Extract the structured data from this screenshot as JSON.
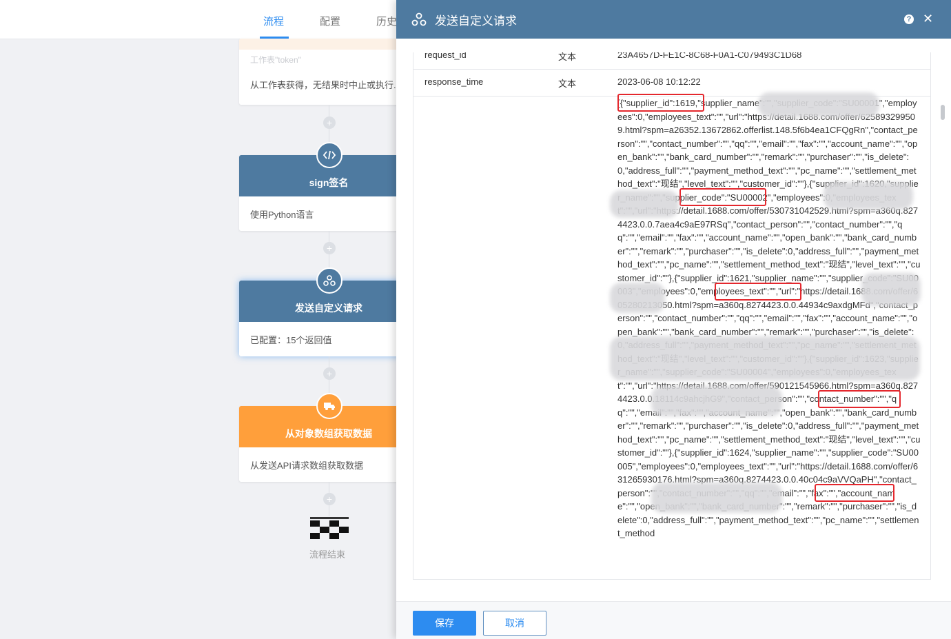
{
  "tabs": [
    {
      "label": "流程"
    },
    {
      "label": "配置"
    },
    {
      "label": "历史"
    }
  ],
  "flow": {
    "top_node_hint": "工作表\"token\"",
    "top_node_desc": "从工作表获得，无结果时中止或执行...",
    "node_sign_title": "sign签名",
    "node_sign_desc": "使用Python语言",
    "node_webhook_title": "发送自定义请求",
    "node_webhook_desc": "已配置：15个返回值",
    "node_array_title": "从对象数组获取数据",
    "node_array_desc": "从发送API请求数组获取数据",
    "end_label": "流程结束"
  },
  "drawer": {
    "title": "发送自定义请求",
    "help_icon": "?",
    "close_icon": "✕",
    "rows": [
      {
        "name": "request_id",
        "type": "文本",
        "value": "23A4657D-FE1C-8C68-F0A1-C079493C1D68"
      },
      {
        "name": "response_time",
        "type": "文本",
        "value": "2023-06-08 10:12:22"
      }
    ],
    "json_text": "[{\"supplier_id\":1619,\"supplier_name\":\"\",\"supplier_code\":\"SU00001\",\"employees\":0,\"employees_text\":\"\",\"url\":\"https://detail.1688.com/offer/625893299509.html?spm=a26352.13672862.offerlist.148.5f6b4ea1CFQgRn\",\"contact_person\":\"\",\"contact_number\":\"\",\"qq\":\"\",\"email\":\"\",\"fax\":\"\",\"account_name\":\"\",\"open_bank\":\"\",\"bank_card_number\":\"\",\"remark\":\"\",\"purchaser\":\"\",\"is_delete\":0,\"address_full\":\"\",\"payment_method_text\":\"\",\"pc_name\":\"\",\"settlement_method_text\":\"现结\",\"level_text\":\"\",\"customer_id\":\"\"},{\"supplier_id\":1620,\"supplier_name\":\"\",\"supplier_code\":\"SU00002\",\"employees\":0,\"employees_text\":\"\",\"url\":\"https://detail.1688.com/offer/530731042529.html?spm=a360q.8274423.0.0.7aea4c9aE97RSq\",\"contact_person\":\"\",\"contact_number\":\"\",\"qq\":\"\",\"email\":\"\",\"fax\":\"\",\"account_name\":\"\",\"open_bank\":\"\",\"bank_card_number\":\"\",\"remark\":\"\",\"purchaser\":\"\",\"is_delete\":0,\"address_full\":\"\",\"payment_method_text\":\"\",\"pc_name\":\"\",\"settlement_method_text\":\"现结\",\"level_text\":\"\",\"customer_id\":\"\"},{\"supplier_id\":1621,\"supplier_name\":\"\",\"supplier_code\":\"SU00003\",\"employees\":0,\"employees_text\":\"\",\"url\":\"https://detail.1688.com/offer/605280213050.html?spm=a360q.8274423.0.0.44934c9axdgMFd\",\"contact_person\":\"\",\"contact_number\":\"\",\"qq\":\"\",\"email\":\"\",\"fax\":\"\",\"account_name\":\"\",\"open_bank\":\"\",\"bank_card_number\":\"\",\"remark\":\"\",\"purchaser\":\"\",\"is_delete\":0,\"address_full\":\"\",\"payment_method_text\":\"\",\"pc_name\":\"\",\"settlement_method_text\":\"现结\",\"level_text\":\"\",\"customer_id\":\"\"},{\"supplier_id\":1623,\"supplier_name\":\"\",\"supplier_code\":\"SU00004\",\"employees\":0,\"employees_text\":\"\",\"url\":\"https://detail.1688.com/offer/590121545966.html?spm=a360q.8274423.0.0.18114c9ahcjhG9\",\"contact_person\":\"\",\"contact_number\":\"\",\"qq\":\"\",\"email\":\"\",\"fax\":\"\",\"account_name\":\"\",\"open_bank\":\"\",\"bank_card_number\":\"\",\"remark\":\"\",\"purchaser\":\"\",\"is_delete\":0,\"address_full\":\"\",\"payment_method_text\":\"\",\"pc_name\":\"\",\"settlement_method_text\":\"现结\",\"level_text\":\"\",\"customer_id\":\"\"},{\"supplier_id\":1624,\"supplier_name\":\"\",\"supplier_code\":\"SU00005\",\"employees\":0,\"employees_text\":\"\",\"url\":\"https://detail.1688.com/offer/631265930176.html?spm=a360q.8274423.0.0.40c04c9aVVQaPH\",\"contact_person\":\"\",\"contact_number\":\"\",\"qq\":\"\",\"email\":\"\",\"fax\":\"\",\"account_name\":\"\",\"open_bank\":\"\",\"bank_card_number\":\"\",\"remark\":\"\",\"purchaser\":\"\",\"is_delete\":0,\"address_full\":\"\",\"payment_method_text\":\"\",\"pc_name\":\"\",\"settlement_method",
    "save_label": "保存",
    "cancel_label": "取消"
  },
  "colors": {
    "accent": "#2d8cf0",
    "header_blue": "#4e7aa0",
    "orange": "#ff9f3b",
    "highlight_red": "#e4272d"
  }
}
